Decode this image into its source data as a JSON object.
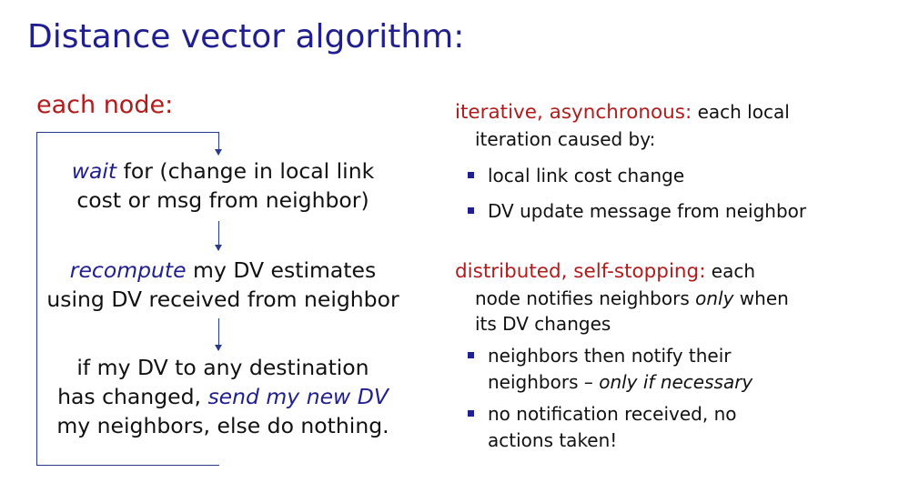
{
  "title": "Distance vector algorithm:",
  "left": {
    "heading": "each node:",
    "step1": {
      "line1_em": "wait",
      "line1_rest": " for (change in local link",
      "line2": "cost or msg from neighbor)"
    },
    "step2": {
      "line1_em": "recompute",
      "line1_rest": " my DV estimates",
      "line2": "using DV received from neighbor"
    },
    "step3": {
      "line1": "if my DV to any destination",
      "line2_pre": "has changed, ",
      "line2_em": "send my new DV",
      "line3": "my neighbors, else do nothing."
    }
  },
  "right": {
    "iter": {
      "heading": "iterative, asynchronous:",
      "heading_rest": " each local",
      "line2": "iteration caused by:",
      "bullets": [
        "local link cost change",
        "DV update message from neighbor"
      ]
    },
    "dist": {
      "heading": "distributed, self-stopping:",
      "heading_rest": " each",
      "line2_pre": "node notifies neighbors ",
      "line2_em": "only",
      "line2_post": " when",
      "line3": "its DV changes",
      "bullet1_line1": "neighbors then notify their",
      "bullet1_line2_pre": "neighbors – ",
      "bullet1_line2_em": "only if necessary",
      "bullet2_line1": "no notification received, no",
      "bullet2_line2": "actions taken!"
    }
  },
  "colors": {
    "title": "#1f1f8f",
    "heading": "#b01c1c",
    "accent": "#1f1f8f"
  }
}
